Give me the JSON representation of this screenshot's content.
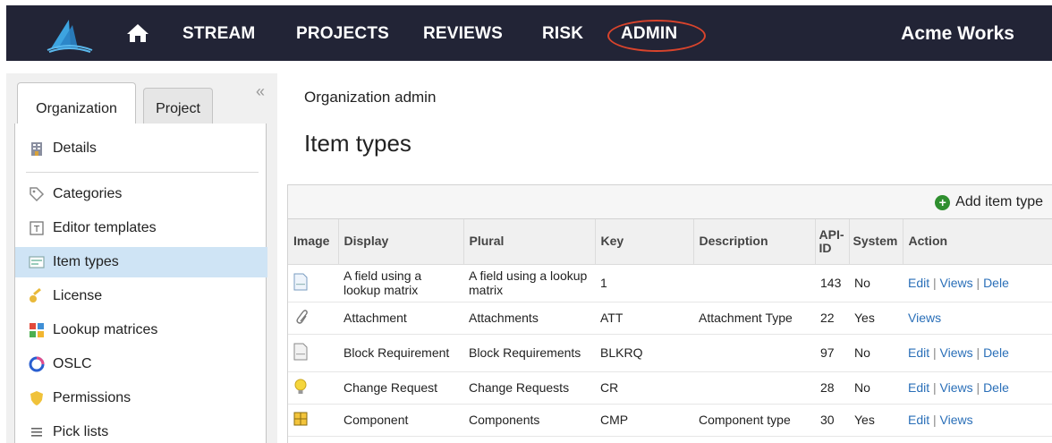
{
  "nav": {
    "items": [
      "STREAM",
      "PROJECTS",
      "REVIEWS",
      "RISK",
      "ADMIN"
    ],
    "org_name": "Acme Works"
  },
  "sidebar": {
    "tabs": [
      "Organization",
      "Project"
    ],
    "collapse_glyph": "«",
    "items": [
      {
        "label": "Details",
        "icon": "building-icon"
      },
      {
        "label": "Categories",
        "icon": "tag-icon"
      },
      {
        "label": "Editor templates",
        "icon": "template-icon"
      },
      {
        "label": "Item types",
        "icon": "item-types-icon",
        "selected": true
      },
      {
        "label": "License",
        "icon": "key-icon"
      },
      {
        "label": "Lookup matrices",
        "icon": "grid-icon"
      },
      {
        "label": "OSLC",
        "icon": "oslc-icon"
      },
      {
        "label": "Permissions",
        "icon": "shield-icon"
      },
      {
        "label": "Pick lists",
        "icon": "list-icon"
      }
    ]
  },
  "main": {
    "breadcrumb": "Organization admin",
    "title": "Item types",
    "add_label": "Add item type",
    "columns": [
      "Image",
      "Display",
      "Plural",
      "Key",
      "Description",
      "API-ID",
      "System",
      "Action"
    ],
    "rows": [
      {
        "icon": "document-icon",
        "display": "A field using a lookup matrix",
        "plural": "A field using a lookup matrix",
        "key": "1",
        "description": "",
        "api_id": "143",
        "system": "No",
        "actions": [
          "Edit",
          "Views",
          "Dele"
        ]
      },
      {
        "icon": "paperclip-icon",
        "display": "Attachment",
        "plural": "Attachments",
        "key": "ATT",
        "description": "Attachment Type",
        "api_id": "22",
        "system": "Yes",
        "actions": [
          "Views"
        ]
      },
      {
        "icon": "document-icon",
        "display": "Block Requirement",
        "plural": "Block Requirements",
        "key": "BLKRQ",
        "description": "",
        "api_id": "97",
        "system": "No",
        "actions": [
          "Edit",
          "Views",
          "Dele"
        ]
      },
      {
        "icon": "lightbulb-icon",
        "display": "Change Request",
        "plural": "Change Requests",
        "key": "CR",
        "description": "",
        "api_id": "28",
        "system": "No",
        "actions": [
          "Edit",
          "Views",
          "Dele"
        ]
      },
      {
        "icon": "component-icon",
        "display": "Component",
        "plural": "Components",
        "key": "CMP",
        "description": "Component type",
        "api_id": "30",
        "system": "Yes",
        "actions": [
          "Edit",
          "Views"
        ]
      }
    ]
  },
  "colors": {
    "topbar": "#222436",
    "admin_highlight": "#d9442c",
    "selected_row": "#cfe4f5",
    "link": "#2a6fb8",
    "add_button": "#2f8f2f"
  }
}
